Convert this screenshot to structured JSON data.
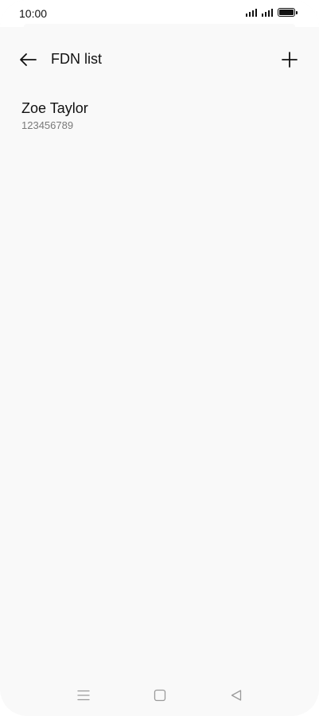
{
  "status_bar": {
    "time": "10:00",
    "icons": [
      "signal-icon",
      "signal-icon",
      "battery-icon"
    ]
  },
  "app_bar": {
    "title": "FDN list",
    "back_icon": "back-arrow-icon",
    "add_icon": "plus-icon"
  },
  "contacts": [
    {
      "name": "Zoe Taylor",
      "number": "123456789"
    }
  ],
  "nav_bar": {
    "icons": [
      "menu-icon",
      "home-icon",
      "back-triangle-icon"
    ]
  },
  "colors": {
    "background": "#f9f9f9",
    "text_primary": "#111111",
    "text_secondary": "#7a7a7a",
    "nav_icon": "#9a9a9a"
  }
}
